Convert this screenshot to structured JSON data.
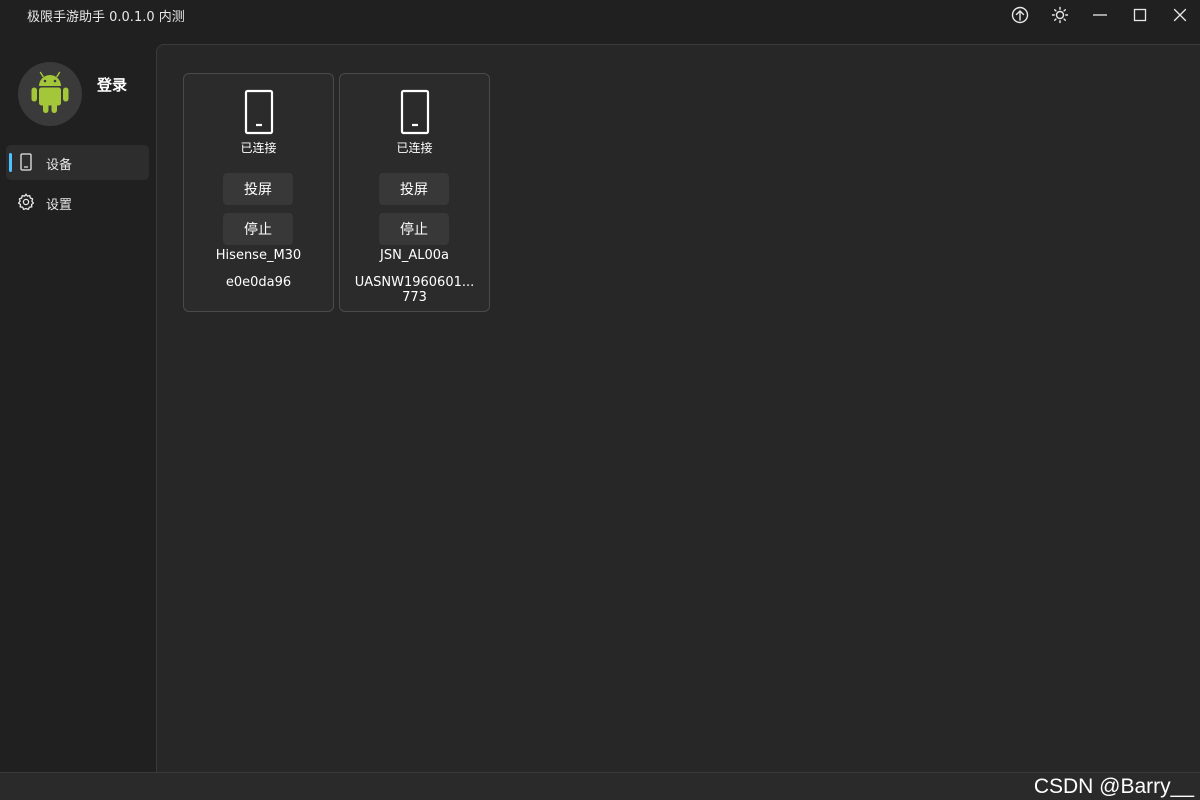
{
  "window": {
    "title": "极限手游助手 0.0.1.0 内测",
    "controls": [
      {
        "name": "upload-icon"
      },
      {
        "name": "theme-sun-icon"
      },
      {
        "name": "minimize-icon"
      },
      {
        "name": "maximize-icon"
      },
      {
        "name": "close-icon"
      }
    ]
  },
  "sidebar": {
    "avatar_icon": "android-robot-icon",
    "login_label": "登录",
    "items": [
      {
        "label": "设备",
        "icon": "phone-icon",
        "active": true
      },
      {
        "label": "设置",
        "icon": "gear-icon",
        "active": false
      }
    ]
  },
  "devices": [
    {
      "status": "已连接",
      "cast_label": "投屏",
      "stop_label": "停止",
      "model": "Hisense_M30",
      "serial_line1": "e0e0da96",
      "serial_line2": ""
    },
    {
      "status": "已连接",
      "cast_label": "投屏",
      "stop_label": "停止",
      "model": "JSN_AL00a",
      "serial_line1": "UASNW1960601...",
      "serial_line2": "773"
    }
  ],
  "watermark": "CSDN @Barry__",
  "colors": {
    "accent": "#4cc2ff",
    "android_green": "#a4c639",
    "background": "#202020",
    "content_background": "#272727"
  }
}
